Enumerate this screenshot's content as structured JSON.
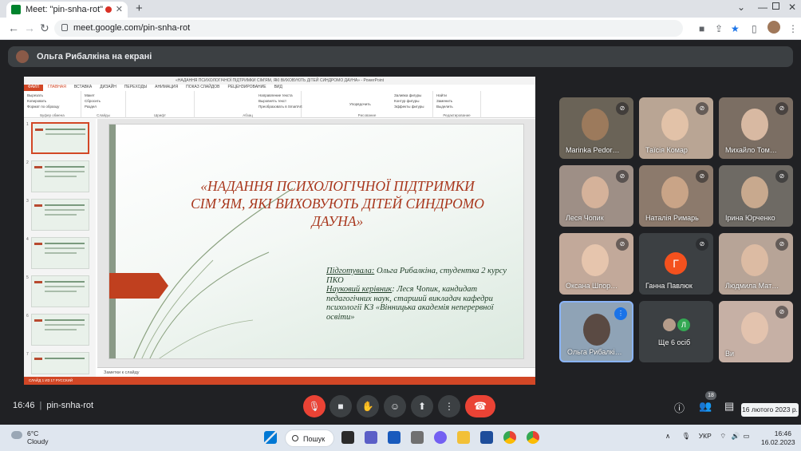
{
  "browser": {
    "tab_title": "Meet: \"pin-snha-rot\"",
    "new_tab": "+",
    "close_tab": "✕",
    "url": "meet.google.com/pin-snha-rot"
  },
  "meet": {
    "presenting_label": "Ольга Рибалкіна на екрані",
    "time": "16:46",
    "meeting_code": "pin-snha-rot",
    "people_count": "18",
    "tooltip_date": "16 лютого 2023 р.",
    "participants": [
      {
        "name": "Marinka Pedor…",
        "muted": true
      },
      {
        "name": "Таїсія Комар",
        "muted": true
      },
      {
        "name": "Михайло Том…",
        "muted": true
      },
      {
        "name": "Леся Чопик",
        "muted": true
      },
      {
        "name": "Наталія Римарь",
        "muted": true
      },
      {
        "name": "Ірина Юрченко",
        "muted": true
      },
      {
        "name": "Оксана Шпор…",
        "muted": true
      },
      {
        "name": "Ганна Павлюк",
        "muted": true,
        "initial": "Г",
        "avatar_color": "#f4511e"
      },
      {
        "name": "Людмила Мат…",
        "muted": true
      },
      {
        "name": "Ольга Рибалкі…",
        "muted": false
      },
      {
        "name": "Ще 6 осіб",
        "muted": false,
        "initial": "Л",
        "avatar_color": "#34a853"
      },
      {
        "name": "Ви",
        "muted": true
      }
    ]
  },
  "powerpoint": {
    "window_title": "«НАДАННЯ ПСИХОЛОГІЧНОЇ ПІДТРИМКИ СІМ'ЯМ, ЯКІ ВИХОВУЮТЬ ДІТЕЙ СИНДРОМО ДАУНА» - PowerPoint",
    "tabs": [
      "ФАЙЛ",
      "ГЛАВНАЯ",
      "ВСТАВКА",
      "ДИЗАЙН",
      "ПЕРЕХОДЫ",
      "АНИМАЦИЯ",
      "ПОКАЗ СЛАЙДОВ",
      "РЕЦЕНЗИРОВАНИЕ",
      "ВИД"
    ],
    "groups": [
      "Буфер обмена",
      "Слайды",
      "Шрифт",
      "Абзац",
      "Рисование",
      "Редактирование"
    ],
    "ribbon_items": {
      "paste": "Вставить",
      "cut": "Вырезать",
      "copy": "Копировать",
      "format": "Формат по образцу",
      "new_slide": "Создать слайд",
      "layout": "Макет",
      "reset": "Сбросить",
      "section": "Раздел",
      "text_dir": "Направление текста",
      "align_text": "Выровнять текст",
      "smartart": "Преобразовать в SmartArt",
      "arrange": "Упорядочить",
      "quick_styles": "Экспресс-стили",
      "fill": "Заливка фигуры",
      "outline": "Контур фигуры",
      "effects": "Эффекты фигуры",
      "find": "Найти",
      "replace": "Заменить",
      "select": "Выделить"
    },
    "slide_title": "«НАДАННЯ ПСИХОЛОГІЧНОЇ ПІДТРИМКИ СІМ’ЯМ, ЯКІ ВИХОВУЮТЬ ДІТЕЙ СИНДРОМО ДАУНА»",
    "prepared_label": "Підготувала:",
    "prepared_text": " Ольга Рибалкіна,  студентка 2 курсу ПКО",
    "supervisor_label": "Науковий  керівник",
    "supervisor_text": ": Леся Чопик, кандидат педагогічних наук, старший викладач кафедри психології КЗ «Вінницька академія неперервної освіти»",
    "notes_placeholder": "Заметки к слайду",
    "status": "СЛАЙД 1 ИЗ 17      РУССКИЙ",
    "slide_numbers": [
      "1",
      "2",
      "3",
      "4",
      "5",
      "6",
      "7"
    ]
  },
  "taskbar": {
    "temp": "6°C",
    "weather": "Cloudy",
    "search": "Пошук",
    "lang": "УКР",
    "time": "16:46",
    "date": "16.02.2023"
  }
}
